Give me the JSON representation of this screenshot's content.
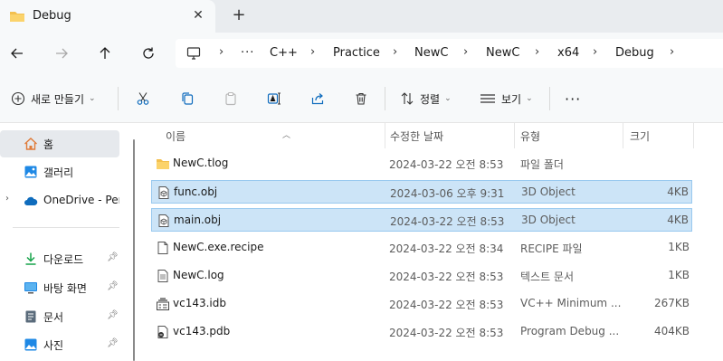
{
  "window": {
    "tab_title": "Debug",
    "close_glyph": "✕",
    "new_tab_glyph": "+"
  },
  "nav": {
    "back_icon": "arrow-left-icon",
    "forward_icon": "arrow-right-icon",
    "up_icon": "arrow-up-icon",
    "refresh_icon": "refresh-icon"
  },
  "breadcrumb": {
    "more": "···",
    "items": [
      "C++",
      "Practice",
      "NewC",
      "NewC",
      "x64",
      "Debug"
    ]
  },
  "commands": {
    "new": "새로 만들기",
    "sort": "정렬",
    "view": "보기",
    "more": "···"
  },
  "sidebar": {
    "items": [
      {
        "label": "홈",
        "icon": "home-icon"
      },
      {
        "label": "갤러리",
        "icon": "gallery-icon"
      },
      {
        "label": "OneDrive - Pers",
        "icon": "cloud-icon"
      },
      {
        "label": "다운로드",
        "icon": "download-icon"
      },
      {
        "label": "바탕 화면",
        "icon": "desktop-icon"
      },
      {
        "label": "문서",
        "icon": "document-icon"
      },
      {
        "label": "사진",
        "icon": "photos-icon"
      }
    ]
  },
  "columns": {
    "name": "이름",
    "modified": "수정한 날짜",
    "type": "유형",
    "size": "크기"
  },
  "files": [
    {
      "name": "NewC.tlog",
      "modified": "2024-03-22 오전 8:53",
      "type": "파일 폴더",
      "size": "",
      "icon": "folder-icon"
    },
    {
      "name": "func.obj",
      "modified": "2024-03-06 오후 9:31",
      "type": "3D Object",
      "size": "4KB",
      "icon": "object-file-icon"
    },
    {
      "name": "main.obj",
      "modified": "2024-03-22 오전 8:53",
      "type": "3D Object",
      "size": "4KB",
      "icon": "object-file-icon"
    },
    {
      "name": "NewC.exe.recipe",
      "modified": "2024-03-22 오전 8:34",
      "type": "RECIPE 파일",
      "size": "1KB",
      "icon": "file-icon"
    },
    {
      "name": "NewC.log",
      "modified": "2024-03-22 오전 8:53",
      "type": "텍스트 문서",
      "size": "1KB",
      "icon": "text-file-icon"
    },
    {
      "name": "vc143.idb",
      "modified": "2024-03-22 오전 8:53",
      "type": "VC++ Minimum ...",
      "size": "267KB",
      "icon": "idb-file-icon"
    },
    {
      "name": "vc143.pdb",
      "modified": "2024-03-22 오전 8:53",
      "type": "Program Debug ...",
      "size": "404KB",
      "icon": "pdb-file-icon"
    }
  ],
  "colors": {
    "selection": "#cce4f7",
    "selection_border": "#99c9ef",
    "folder": "#f3c04f",
    "accent": "#0f6cbd"
  }
}
